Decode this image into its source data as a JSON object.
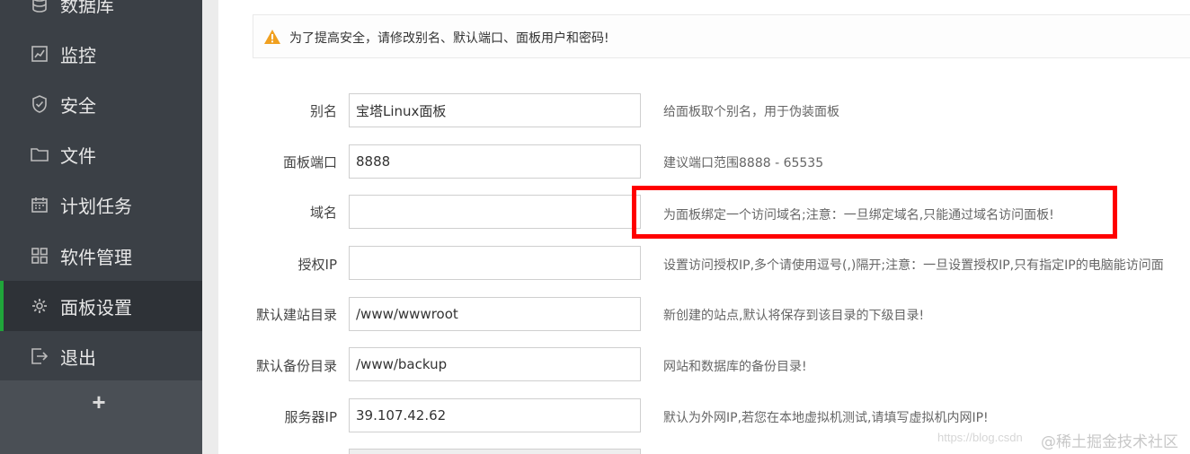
{
  "sidebar": {
    "items": [
      {
        "label": "数据库",
        "icon": "database-icon"
      },
      {
        "label": "监控",
        "icon": "monitor-icon"
      },
      {
        "label": "安全",
        "icon": "shield-icon"
      },
      {
        "label": "文件",
        "icon": "folder-icon"
      },
      {
        "label": "计划任务",
        "icon": "calendar-icon"
      },
      {
        "label": "软件管理",
        "icon": "grid-icon"
      },
      {
        "label": "面板设置",
        "icon": "gear-icon",
        "active": true
      },
      {
        "label": "退出",
        "icon": "logout-icon"
      }
    ],
    "add_label": "+"
  },
  "alert": {
    "text": "为了提高安全，请修改别名、默认端口、面板用户和密码!",
    "icon": "warning-icon"
  },
  "form": {
    "alias": {
      "label": "别名",
      "value": "宝塔Linux面板",
      "help": "给面板取个别名，用于伪装面板"
    },
    "port": {
      "label": "面板端口",
      "value": "8888",
      "help": "建议端口范围8888 - 65535"
    },
    "domain": {
      "label": "域名",
      "value": "",
      "help": "为面板绑定一个访问域名;注意：一旦绑定域名,只能通过域名访问面板!"
    },
    "auth_ip": {
      "label": "授权IP",
      "value": "",
      "help": "设置访问授权IP,多个请使用逗号(,)隔开;注意：一旦设置授权IP,只有指定IP的电脑能访问面"
    },
    "site_dir": {
      "label": "默认建站目录",
      "value": "/www/wwwroot",
      "help": "新创建的站点,默认将保存到该目录的下级目录!"
    },
    "backup_dir": {
      "label": "默认备份目录",
      "value": "/www/backup",
      "help": "网站和数据库的备份目录!"
    },
    "server_ip": {
      "label": "服务器IP",
      "value": "39.107.42.62",
      "help": "默认为外网IP,若您在本地虚拟机测试,请填写虚拟机内网IP!"
    }
  },
  "watermark": {
    "url_text": "https://blog.csdn",
    "brand_text": "@稀土掘金技术社区"
  },
  "colors": {
    "sidebar_bg": "#3b4046",
    "active_accent": "#20a53a",
    "highlight": "#ff0000",
    "warning": "#f0a020"
  }
}
